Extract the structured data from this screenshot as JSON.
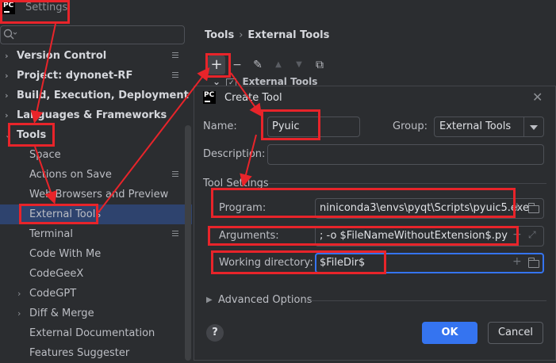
{
  "window": {
    "title": "Settings",
    "logo_text": "PC"
  },
  "sidebar": {
    "items": [
      {
        "label": "Version Control",
        "chevron": "›",
        "bold": true
      },
      {
        "label": "Project: dynonet-RF",
        "chevron": "›",
        "bold": true
      },
      {
        "label": "Build, Execution, Deployment",
        "chevron": "›",
        "bold": true
      },
      {
        "label": "Languages & Frameworks",
        "chevron": "›",
        "bold": true
      },
      {
        "label": "Tools",
        "chevron": "⌄",
        "bold": true
      },
      {
        "label": "Space"
      },
      {
        "label": "Actions on Save"
      },
      {
        "label": "Web Browsers and Preview"
      },
      {
        "label": "External Tools",
        "selected": true
      },
      {
        "label": "Terminal"
      },
      {
        "label": "Code With Me"
      },
      {
        "label": "CodeGeeX"
      },
      {
        "label": "CodeGPT",
        "chevron": "›"
      },
      {
        "label": "Diff & Merge",
        "chevron": "›"
      },
      {
        "label": "External Documentation"
      },
      {
        "label": "Features Suggester"
      }
    ]
  },
  "breadcrumb": {
    "parent": "Tools",
    "separator": "›",
    "current": "External Tools"
  },
  "toolbar": {
    "add": "+",
    "remove": "−",
    "edit": "✎",
    "up": "▲",
    "down": "▼",
    "copy": "⧉"
  },
  "tree": {
    "group_label": "External Tools",
    "chevron": "⌄",
    "check": "✓"
  },
  "dialog": {
    "title": "Create Tool",
    "logo_text": "PC",
    "close": "✕",
    "name_label": "Name:",
    "name_value": "Pyuic",
    "group_label": "Group:",
    "group_value": "External Tools",
    "description_label": "Description:",
    "description_value": "",
    "section_title": "Tool Settings",
    "program_label": "Program:",
    "program_value": "niniconda3\\envs\\pyqt\\Scripts\\pyuic5.exe",
    "arguments_label": "Arguments:",
    "arguments_value": "; -o $FileNameWithoutExtension$.py",
    "workdir_label": "Working directory:",
    "workdir_value": "$FileDir$",
    "advanced": "Advanced Options",
    "help": "?",
    "ok": "OK",
    "cancel": "Cancel",
    "plus": "+",
    "expand": "⤢"
  },
  "colors": {
    "accent": "#3574f0",
    "highlight": "#e8242a",
    "selection": "#2e436e"
  }
}
